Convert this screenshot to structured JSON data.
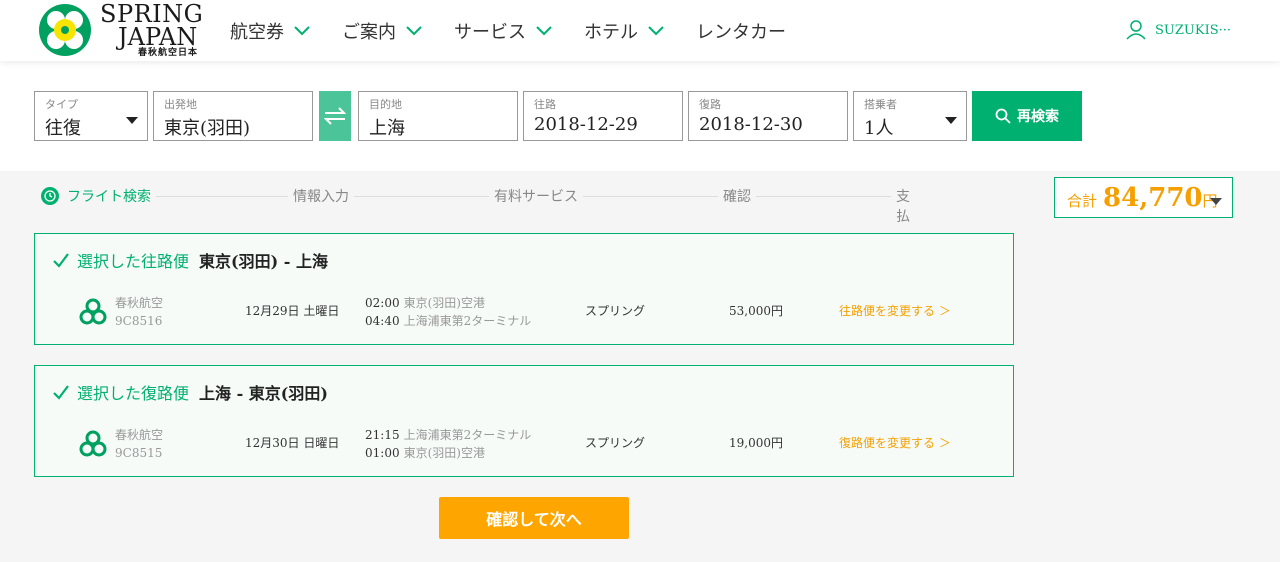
{
  "brand": {
    "line1": "SPRING",
    "line2": "JAPAN",
    "line3": "春秋航空日本",
    "color": "#00b070"
  },
  "nav": {
    "items": [
      {
        "label": "航空券",
        "has_dropdown": true
      },
      {
        "label": "ご案内",
        "has_dropdown": true
      },
      {
        "label": "サービス",
        "has_dropdown": true
      },
      {
        "label": "ホテル",
        "has_dropdown": true
      },
      {
        "label": "レンタカー",
        "has_dropdown": false
      }
    ]
  },
  "user": {
    "name": "SUZUKIS···",
    "icon": "user-icon"
  },
  "search": {
    "type": {
      "label": "タイプ",
      "value": "往復"
    },
    "origin": {
      "label": "出発地",
      "value": "東京(羽田)"
    },
    "destination": {
      "label": "目的地",
      "value": "上海"
    },
    "outbound": {
      "label": "往路",
      "value": "2018-12-29"
    },
    "return": {
      "label": "復路",
      "value": "2018-12-30"
    },
    "passengers": {
      "label": "搭乗者",
      "value": "1人"
    },
    "research_label": "再検索"
  },
  "steps": [
    "フライト検索",
    "情報入力",
    "有料サービス",
    "確認",
    "支払"
  ],
  "total": {
    "label": "合計",
    "value": "84,770",
    "unit": "円"
  },
  "flights": [
    {
      "selected_label": "選択した往路便",
      "route": "東京(羽田) - 上海",
      "airline": "春秋航空",
      "flight_no": "9C8516",
      "date": "12月29日 土曜日",
      "dep_time": "02:00",
      "dep_airport": "東京(羽田)空港",
      "arr_time": "04:40",
      "arr_airport": "上海浦東第2ターミナル",
      "fare": "スプリング",
      "price": "53,000円",
      "change_label": "往路便を変更する ＞"
    },
    {
      "selected_label": "選択した復路便",
      "route": "上海 - 東京(羽田)",
      "airline": "春秋航空",
      "flight_no": "9C8515",
      "date": "12月30日 日曜日",
      "dep_time": "21:15",
      "dep_airport": "上海浦東第2ターミナル",
      "arr_time": "01:00",
      "arr_airport": "東京(羽田)空港",
      "fare": "スプリング",
      "price": "19,000円",
      "change_label": "復路便を変更する ＞"
    }
  ],
  "next_label": "確認して次へ",
  "colors": {
    "accent": "#00b070",
    "price": "#f5a000",
    "next": "#ffa500"
  }
}
